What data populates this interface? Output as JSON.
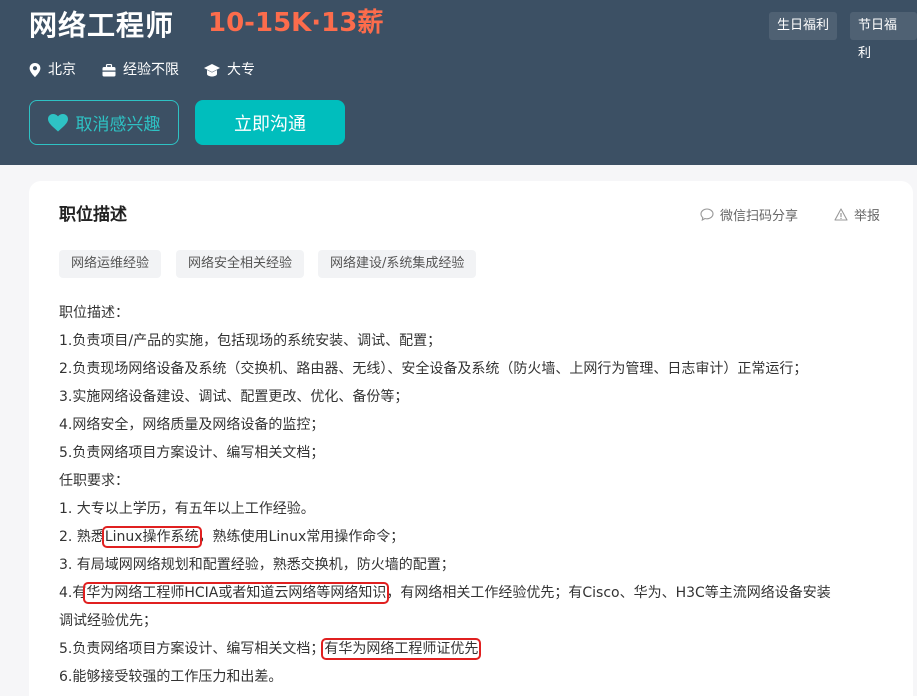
{
  "header": {
    "job_title": "网络工程师",
    "salary": "10-15K·13薪",
    "tags": [
      "生日福利",
      "节日福利"
    ],
    "location": "北京",
    "experience": "经验不限",
    "education": "大专",
    "interest_button": "取消感兴趣",
    "chat_button": "立即沟通"
  },
  "card": {
    "title": "职位描述",
    "share_label": "微信扫码分享",
    "report_label": "举报",
    "skill_tags": [
      "网络运维经验",
      "网络安全相关经验",
      "网络建设/系统集成经验"
    ],
    "lines": [
      "职位描述：",
      "1.负责项目/产品的实施，包括现场的系统安装、调试、配置；",
      "2.负责现场网络设备及系统（交换机、路由器、无线）、安全设备及系统（防火墙、上网行为管理、日志审计）正常运行；",
      "3.实施网络设备建设、调试、配置更改、优化、备份等；",
      "4.网络安全，网络质量及网络设备的监控；",
      "5.负责网络项目方案设计、编写相关文档；",
      "任职要求：",
      "1. 大专以上学历，有五年以上工作经验。"
    ],
    "line_9": {
      "prefix": "2. 熟悉",
      "highlight": "Linux操作系统",
      "suffix": "，熟练使用Linux常用操作命令；"
    },
    "line_10": "3. 有局域网网络规划和配置经验，熟悉交换机，防火墙的配置；",
    "line_11": {
      "prefix": "4.有",
      "highlight": "华为网络工程师HCIA或者知道云网络等网络知识",
      "suffix": "，有网络相关工作经验优先；有Cisco、华为、H3C等主流网络设备安装"
    },
    "line_12": "调试经验优先；",
    "line_13": {
      "prefix": "5.负责网络项目方案设计、编写相关文档；",
      "highlight": "有华为网络工程师证优先"
    },
    "line_14": "6.能够接受较强的工作压力和出差。"
  },
  "colors": {
    "header_bg": "#3c5064",
    "salary": "#fc6c4c",
    "accent": "#00bebd",
    "highlight_box": "#e02020"
  },
  "icons": [
    "location-icon",
    "briefcase-icon",
    "graduation-cap-icon",
    "heart-icon",
    "wechat-chat-icon",
    "warning-icon"
  ]
}
